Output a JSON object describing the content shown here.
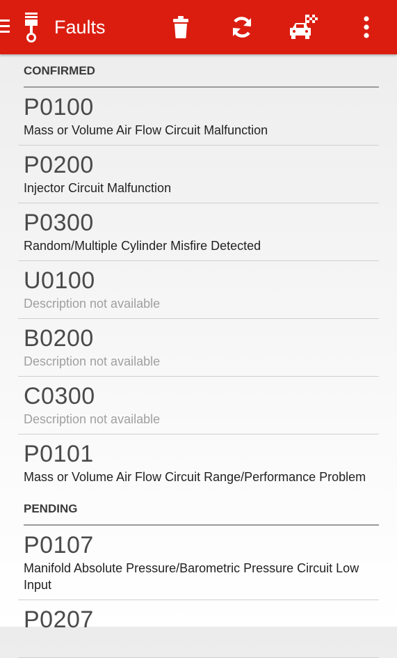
{
  "appbar": {
    "title": "Faults",
    "actions": [
      "delete-icon",
      "refresh-icon",
      "car-race-icon",
      "overflow-menu-icon"
    ],
    "color": "#db1d10"
  },
  "sections": [
    {
      "header": "CONFIRMED",
      "items": [
        {
          "code": "P0100",
          "desc": "Mass or Volume Air Flow Circuit Malfunction",
          "available": true
        },
        {
          "code": "P0200",
          "desc": "Injector Circuit Malfunction",
          "available": true
        },
        {
          "code": "P0300",
          "desc": "Random/Multiple Cylinder Misfire Detected",
          "available": true
        },
        {
          "code": "U0100",
          "desc": "Description not available",
          "available": false
        },
        {
          "code": "B0200",
          "desc": "Description not available",
          "available": false
        },
        {
          "code": "C0300",
          "desc": "Description not available",
          "available": false
        },
        {
          "code": "P0101",
          "desc": "Mass or Volume Air Flow Circuit Range/Performance Problem",
          "available": true
        }
      ]
    },
    {
      "header": "PENDING",
      "items": [
        {
          "code": "P0107",
          "desc": "Manifold Absolute Pressure/Barometric Pressure Circuit Low Input",
          "available": true
        },
        {
          "code": "P0207",
          "desc": "",
          "available": true
        }
      ]
    }
  ]
}
